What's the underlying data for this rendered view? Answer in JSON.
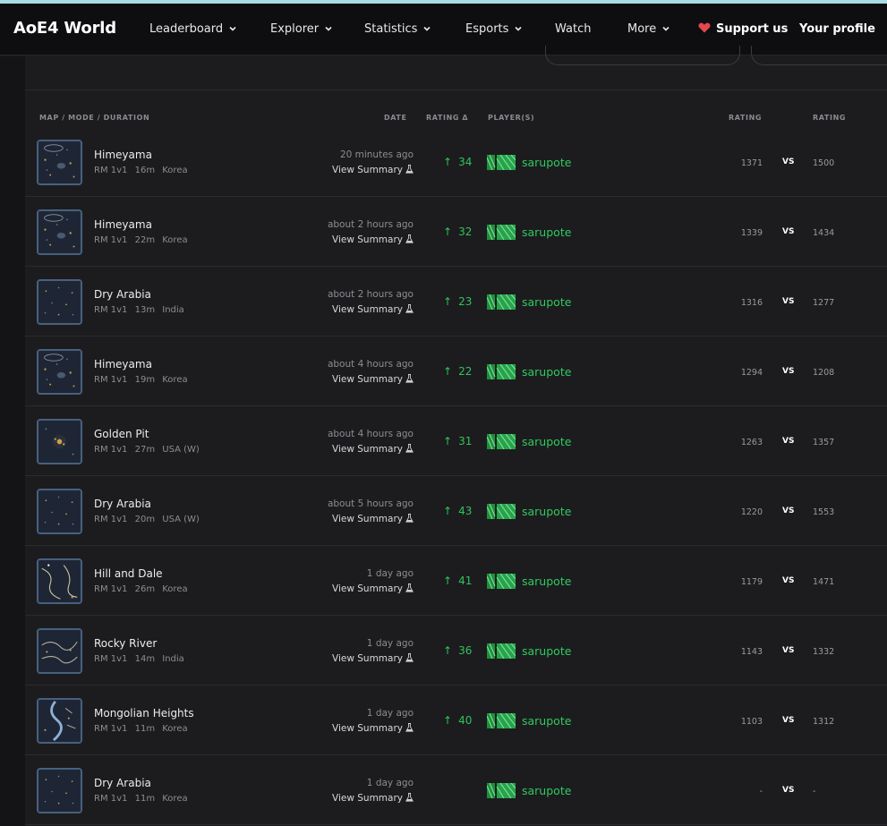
{
  "app": {
    "brand": "AoE4 World",
    "nav": [
      {
        "label": "Leaderboard",
        "dropdown": true
      },
      {
        "label": "Explorer",
        "dropdown": true
      },
      {
        "label": "Statistics",
        "dropdown": true
      },
      {
        "label": "Esports",
        "dropdown": true
      },
      {
        "label": "Watch",
        "dropdown": false
      },
      {
        "label": "More",
        "dropdown": true
      }
    ],
    "support_label": "Support us",
    "profile_label": "Your profile",
    "colors": {
      "heart": "#e5484d",
      "positive": "#2fc45a",
      "navbar": "#0e0e10",
      "background": "#1c1c1f",
      "top_accent": "#a7dde6"
    }
  },
  "table": {
    "headers": {
      "map": "MAP / MODE / DURATION",
      "date": "DATE",
      "delta": "RATING Δ",
      "players": "PLAYER(S)",
      "rating_left": "RATING",
      "rating_right": "RATING"
    },
    "vs_label": "VS",
    "summary_label": "View Summary",
    "rows": [
      {
        "map": "Himeyama",
        "mode": "RM 1v1",
        "duration": "16m",
        "server": "Korea",
        "date": "20 minutes ago",
        "delta": "34",
        "player": "sarupote",
        "rating": "1371",
        "opp_rating": "1500",
        "thumb": "himeyama"
      },
      {
        "map": "Himeyama",
        "mode": "RM 1v1",
        "duration": "22m",
        "server": "Korea",
        "date": "about 2 hours ago",
        "delta": "32",
        "player": "sarupote",
        "rating": "1339",
        "opp_rating": "1434",
        "thumb": "himeyama"
      },
      {
        "map": "Dry Arabia",
        "mode": "RM 1v1",
        "duration": "13m",
        "server": "India",
        "date": "about 2 hours ago",
        "delta": "23",
        "player": "sarupote",
        "rating": "1316",
        "opp_rating": "1277",
        "thumb": "dryarabia"
      },
      {
        "map": "Himeyama",
        "mode": "RM 1v1",
        "duration": "19m",
        "server": "Korea",
        "date": "about 4 hours ago",
        "delta": "22",
        "player": "sarupote",
        "rating": "1294",
        "opp_rating": "1208",
        "thumb": "himeyama"
      },
      {
        "map": "Golden Pit",
        "mode": "RM 1v1",
        "duration": "27m",
        "server": "USA (W)",
        "date": "about 4 hours ago",
        "delta": "31",
        "player": "sarupote",
        "rating": "1263",
        "opp_rating": "1357",
        "thumb": "goldenpit"
      },
      {
        "map": "Dry Arabia",
        "mode": "RM 1v1",
        "duration": "20m",
        "server": "USA (W)",
        "date": "about 5 hours ago",
        "delta": "43",
        "player": "sarupote",
        "rating": "1220",
        "opp_rating": "1553",
        "thumb": "dryarabia"
      },
      {
        "map": "Hill and Dale",
        "mode": "RM 1v1",
        "duration": "26m",
        "server": "Korea",
        "date": "1 day ago",
        "delta": "41",
        "player": "sarupote",
        "rating": "1179",
        "opp_rating": "1471",
        "thumb": "hillanddale"
      },
      {
        "map": "Rocky River",
        "mode": "RM 1v1",
        "duration": "14m",
        "server": "India",
        "date": "1 day ago",
        "delta": "36",
        "player": "sarupote",
        "rating": "1143",
        "opp_rating": "1332",
        "thumb": "rockyriver"
      },
      {
        "map": "Mongolian Heights",
        "mode": "RM 1v1",
        "duration": "11m",
        "server": "Korea",
        "date": "1 day ago",
        "delta": "40",
        "player": "sarupote",
        "rating": "1103",
        "opp_rating": "1312",
        "thumb": "mongolian"
      },
      {
        "map": "Dry Arabia",
        "mode": "RM 1v1",
        "duration": "11m",
        "server": "Korea",
        "date": "1 day ago",
        "delta": "",
        "player": "sarupote",
        "rating": "-",
        "opp_rating": "-",
        "thumb": "dryarabia"
      }
    ]
  }
}
